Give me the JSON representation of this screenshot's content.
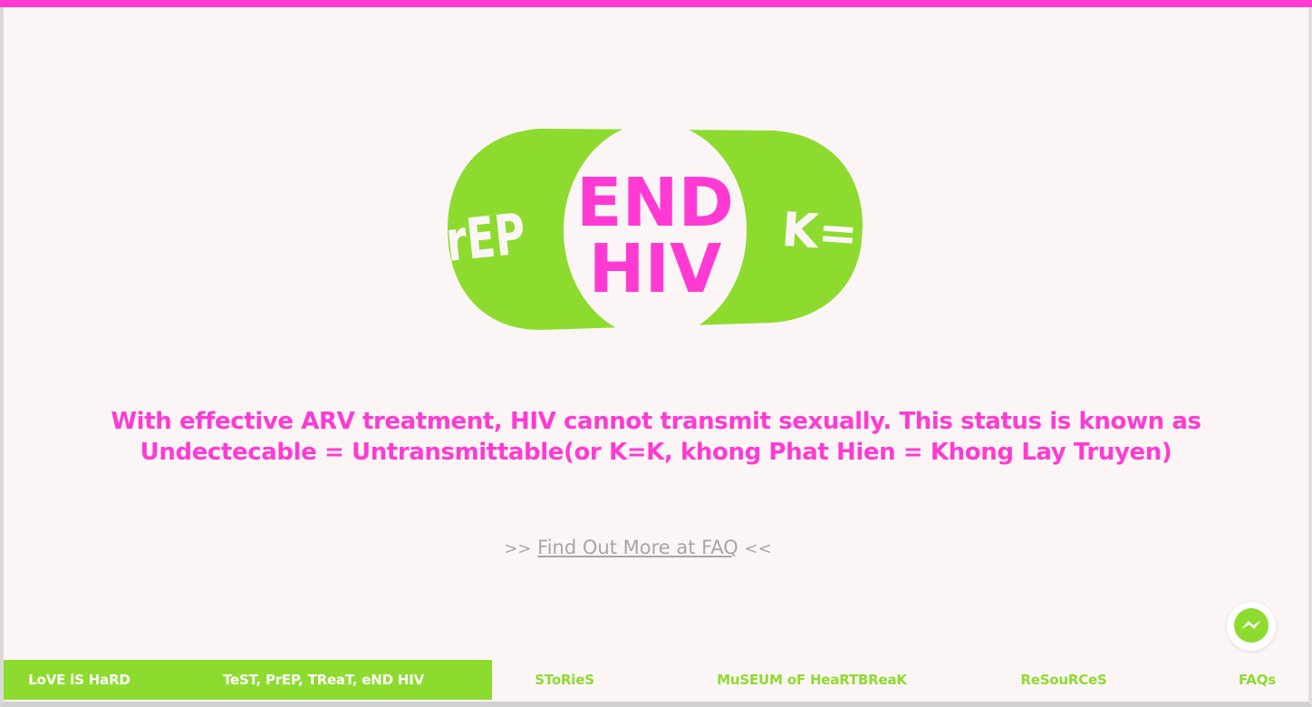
{
  "colors": {
    "brand_pink": "#ff3ad3",
    "brand_green": "#8edb2f",
    "background": "#fbf6f5",
    "muted_text": "#a6a6a6"
  },
  "hero": {
    "left_label": "PrEP",
    "center_line1": "END",
    "center_line2": "HIV",
    "right_label": "K=K"
  },
  "message": {
    "line1": "With effective ARV treatment, HIV cannot transmit sexually. This status is known as",
    "line2": "Undectecable = Untransmittable(or K=K, khong Phat Hien = Khong Lay Truyen)"
  },
  "faq": {
    "prefix": ">>",
    "link_text": "Find Out More at FAQ",
    "suffix": "<<"
  },
  "messenger": {
    "icon": "messenger-icon"
  },
  "nav": {
    "items": [
      {
        "label": "LoVE iS HaRD",
        "active": true
      },
      {
        "label": "TeST, PrEP, TReaT, eND HIV",
        "active": true
      },
      {
        "label": "SToRieS",
        "active": false
      },
      {
        "label": "MuSEUM oF HeaRTBReaK",
        "active": false
      },
      {
        "label": "ReSouRCeS",
        "active": false
      },
      {
        "label": "FAQs",
        "active": false
      }
    ]
  }
}
